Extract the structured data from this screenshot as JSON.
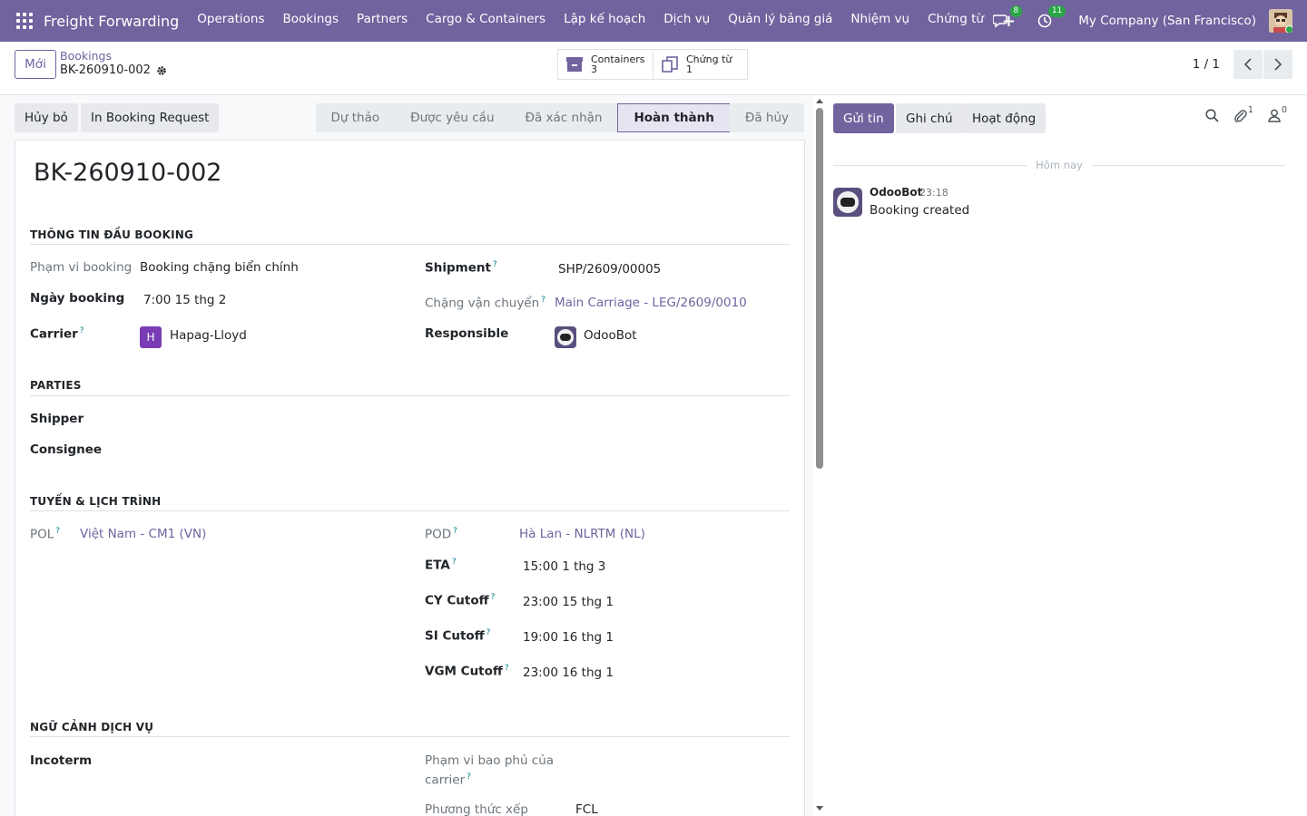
{
  "navbar": {
    "brand": "Freight Forwarding",
    "menu": [
      "Operations",
      "Bookings",
      "Partners",
      "Cargo & Containers",
      "Lập kế hoạch",
      "Dịch vụ",
      "Quản lý bảng giá",
      "Nhiệm vụ",
      "Chứng từ"
    ],
    "plus": "+",
    "messages_count": "8",
    "activities_count": "11",
    "company": "My Company (San Francisco)",
    "accent_color": "#71639e"
  },
  "control": {
    "new_label": "Mới",
    "breadcrumb_parent": "Bookings",
    "breadcrumb_current": "BK-260910-002",
    "smart_buttons": [
      {
        "label": "Containers",
        "count": "3",
        "icon": "archive-icon"
      },
      {
        "label": "Chứng từ",
        "count": "1",
        "icon": "documents-icon"
      }
    ],
    "pager": "1 / 1"
  },
  "actions": {
    "cancel": "Hủy bỏ",
    "print": "In Booking Request"
  },
  "statusbar": {
    "stages": [
      "Dự thảo",
      "Được yêu cầu",
      "Đã xác nhận",
      "Hoàn thành",
      "Đã hủy"
    ],
    "active": "Hoàn thành"
  },
  "record": {
    "title": "BK-260910-002",
    "sections": {
      "header": "THÔNG TIN ĐẦU BOOKING",
      "parties": "PARTIES",
      "route": "TUYẾN & LỊCH TRÌNH",
      "service": "NGỮ CẢNH DỊCH VỤ"
    },
    "fields": {
      "scope_label": "Phạm vi booking",
      "scope_value": "Booking chặng biển chính",
      "date_label": "Ngày booking",
      "date_value": "7:00 15 thg 2",
      "carrier_label": "Carrier",
      "carrier_initial": "H",
      "carrier_value": "Hapag-Lloyd",
      "shipment_label": "Shipment",
      "shipment_value": "SHP/2609/00005",
      "leg_label": "Chặng vận chuyển",
      "leg_value": "Main Carriage - LEG/2609/0010",
      "responsible_label": "Responsible",
      "responsible_value": "OdooBot",
      "shipper_label": "Shipper",
      "consignee_label": "Consignee",
      "pol_label": "POL",
      "pol_value": "Việt Nam - CM1 (VN)",
      "pod_label": "POD",
      "pod_value": "Hà Lan - NLRTM (NL)",
      "eta_label": "ETA",
      "eta_value": "15:00 1 thg 3",
      "cy_label": "CY Cutoff",
      "cy_value": "23:00 15 thg 1",
      "si_label": "SI Cutoff",
      "si_value": "19:00 16 thg 1",
      "vgm_label": "VGM Cutoff",
      "vgm_value": "23:00 16 thg 1",
      "incoterm_label": "Incoterm",
      "coverage_label_1": "Phạm vi bao phủ của",
      "coverage_label_2": "carrier",
      "loading_label": "Phương thức xếp",
      "loading_value": "FCL"
    },
    "help_mark": "?"
  },
  "chatter": {
    "send": "Gửi tin",
    "note": "Ghi chú",
    "activity": "Hoạt động",
    "attachments_count": "1",
    "followers_count": "0",
    "date_separator": "Hôm nay",
    "message": {
      "author": "OdooBot",
      "time": "23:18",
      "body": "Booking created"
    }
  }
}
